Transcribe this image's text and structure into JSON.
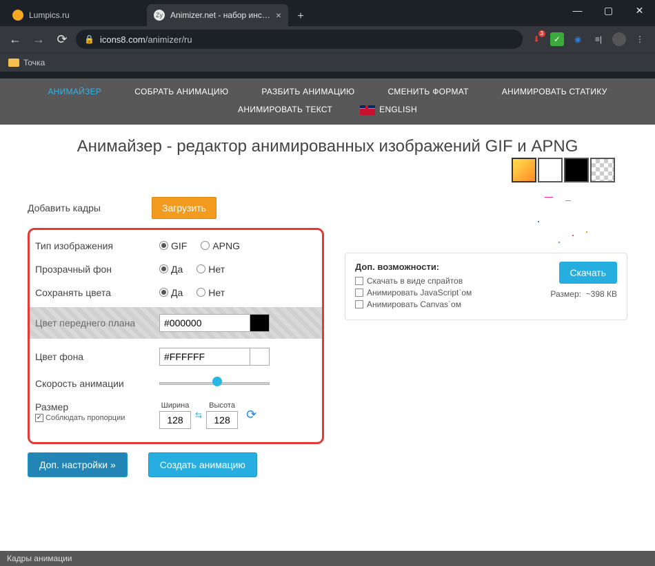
{
  "window": {
    "min": "—",
    "max": "▢",
    "close": "✕"
  },
  "tabs": {
    "t1": {
      "title": "Lumpics.ru"
    },
    "t2": {
      "title": "Animizer.net - набор инструмент"
    },
    "newtab": "+"
  },
  "addr": {
    "back": "←",
    "fwd": "→",
    "reload": "⟳",
    "host": "icons8.com",
    "path": "/animizer/ru",
    "download_badge": "3",
    "menu": "⋮"
  },
  "bookmarks": {
    "item1": "Точка"
  },
  "nav": {
    "animizer": "АНИМАЙЗЕР",
    "assemble": "СОБРАТЬ АНИМАЦИЮ",
    "split": "РАЗБИТЬ АНИМАЦИЮ",
    "convert": "СМЕНИТЬ ФОРМАТ",
    "anim_static": "АНИМИРОВАТЬ СТАТИКУ",
    "anim_text": "АНИМИРОВАТЬ ТЕКСТ",
    "english": "ENGLISH"
  },
  "title": "Анимайзер - редактор анимированных изображений GIF и APNG",
  "form": {
    "add_frames": "Добавить кадры",
    "upload": "Загрузить",
    "img_type": "Тип изображения",
    "gif": "GIF",
    "apng": "APNG",
    "transparent_bg": "Прозрачный фон",
    "yes": "Да",
    "no": "Нет",
    "keep_colors": "Сохранять цвета",
    "fg_color": "Цвет переднего плана",
    "fg_value": "#000000",
    "bg_color": "Цвет фона",
    "bg_value": "#FFFFFF",
    "speed": "Скорость анимации",
    "size": "Размер",
    "width_label": "Ширина",
    "height_label": "Высота",
    "width": "128",
    "height": "128",
    "keep_prop": "Соблюдать пропорции",
    "more": "Доп. настройки »",
    "create": "Создать анимацию"
  },
  "extras": {
    "title": "Доп. возможности:",
    "opt1": "Скачать в виде спрайтов",
    "opt2": "Анимировать JavaScript`ом",
    "opt3": "Анимировать Canvas`ом",
    "download": "Скачать",
    "size_label": "Размер:",
    "size_value": "~398 КВ"
  },
  "footer": "Кадры анимации"
}
